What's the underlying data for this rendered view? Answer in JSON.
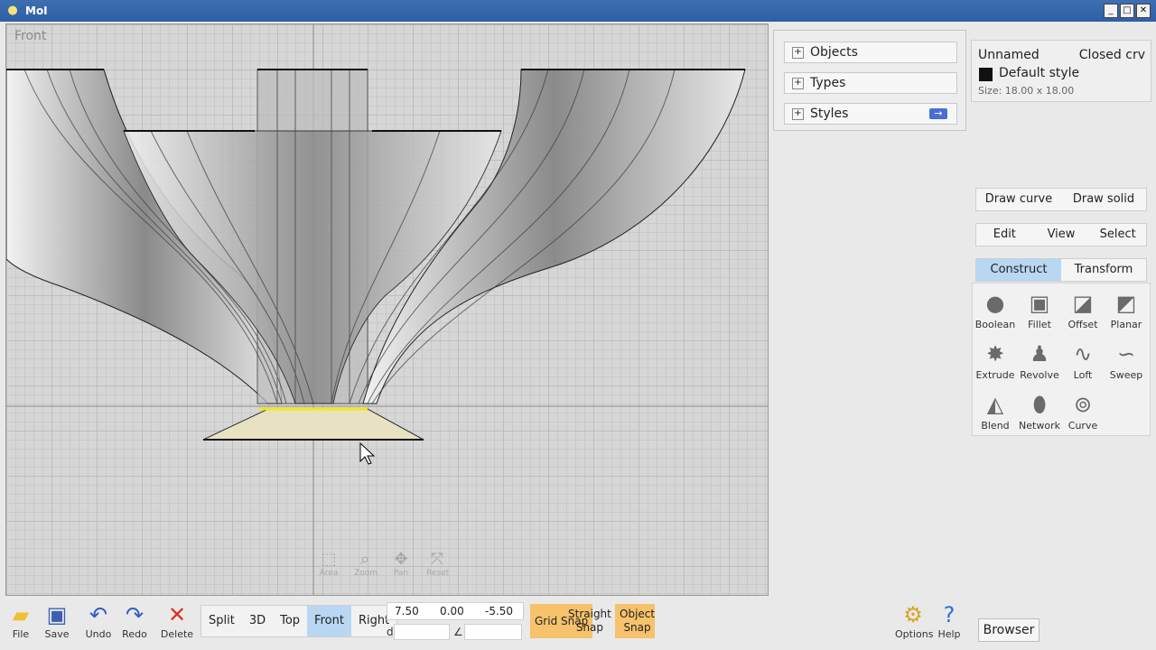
{
  "window": {
    "title": "MoI"
  },
  "viewport": {
    "label": "Front",
    "nav": [
      "Area",
      "Zoom",
      "Pan",
      "Reset"
    ]
  },
  "scene_browser": {
    "items": [
      {
        "label": "Objects"
      },
      {
        "label": "Types"
      },
      {
        "label": "Styles"
      }
    ]
  },
  "properties": {
    "name": "Unnamed",
    "type": "Closed crv",
    "style": "Default style",
    "size": "Size: 18.00 x 18.00",
    "style_color": "#111111"
  },
  "palette": {
    "row1": [
      "Draw curve",
      "Draw solid"
    ],
    "row2": [
      "Edit",
      "View",
      "Select"
    ],
    "row3": [
      "Construct",
      "Transform"
    ],
    "active_tab": "Construct",
    "tools": [
      "Boolean",
      "Fillet",
      "Offset",
      "Planar",
      "Extrude",
      "Revolve",
      "Loft",
      "Sweep",
      "Blend",
      "Network",
      "Curve"
    ]
  },
  "toolbar": {
    "file": "File",
    "save": "Save",
    "undo": "Undo",
    "redo": "Redo",
    "delete": "Delete",
    "views": [
      "Split",
      "3D",
      "Top",
      "Front",
      "Right"
    ],
    "active_view": "Front",
    "coords": {
      "x": "7.50",
      "y": "0.00",
      "z": "-5.50",
      "d_label": "d",
      "angle_label": "∠"
    },
    "grid_snap": "Grid Snap",
    "straight_snap": "Straight Snap",
    "object_snap": "Object Snap",
    "options": "Options",
    "help": "Help",
    "browser": "Browser"
  },
  "colors": {
    "accent_blue": "#b9d7f2",
    "snap_on": "#f6c26b",
    "title_bar": "#3467b0"
  }
}
